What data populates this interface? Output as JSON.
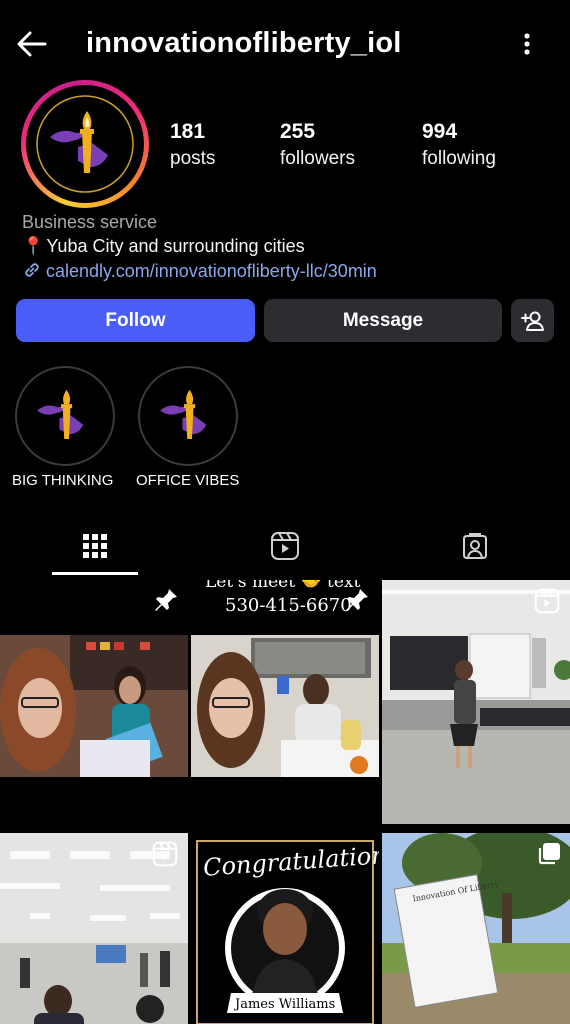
{
  "header": {
    "username": "innovationofliberty_iol",
    "back_icon": "arrow-left-icon",
    "menu_icon": "more-vertical-icon"
  },
  "profile": {
    "stats": [
      {
        "value": "181",
        "label": "posts"
      },
      {
        "value": "255",
        "label": "followers"
      },
      {
        "value": "994",
        "label": "following"
      }
    ],
    "category": "Business service",
    "location_emoji": "📍",
    "location": "Yuba City and surrounding cities",
    "link": "calendly.com/innovationofliberty-llc/30min"
  },
  "actions": {
    "follow_label": "Follow",
    "message_label": "Message",
    "add_user_icon": "add-person-icon"
  },
  "highlights": [
    {
      "label": "BIG THINKING"
    },
    {
      "label": "OFFICE VIBES"
    }
  ],
  "tabs": [
    {
      "name": "posts-grid",
      "icon": "grid-icon",
      "active": true
    },
    {
      "name": "reels",
      "icon": "reels-icon",
      "active": false
    },
    {
      "name": "tagged",
      "icon": "tagged-icon",
      "active": false
    }
  ],
  "posts": [
    {
      "type": "photo",
      "pinned": true
    },
    {
      "type": "photo",
      "pinned": true,
      "overlay_line1": "Let's meet 🤝 text",
      "overlay_line2": "530-415-6670"
    },
    {
      "type": "reel",
      "pinned": false
    },
    {
      "type": "reel",
      "pinned": false
    },
    {
      "type": "photo",
      "pinned": false,
      "title": "Congratulations",
      "name": "James Williams"
    },
    {
      "type": "carousel",
      "pinned": false,
      "sign_title": "Innovation Of Liberty"
    }
  ],
  "colors": {
    "accent": "#4a5df9",
    "button_secondary": "#2b2d31",
    "link": "#8aa7e8",
    "logo_purple": "#7b3fb5",
    "logo_flame": "#f2b01e"
  }
}
